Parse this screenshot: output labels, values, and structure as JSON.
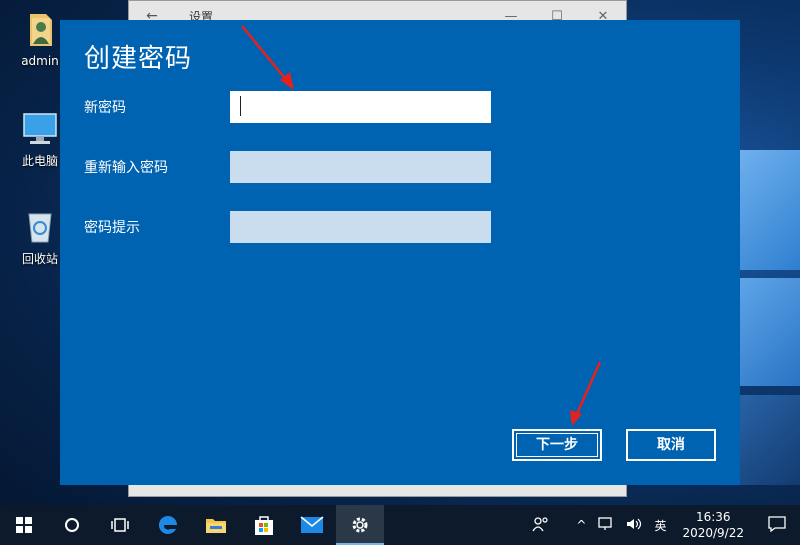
{
  "desktop": {
    "icons": [
      {
        "label": "admin"
      },
      {
        "label": "此电脑"
      },
      {
        "label": "回收站"
      }
    ]
  },
  "settings_window": {
    "title": "设置",
    "back_glyph": "←",
    "minimize_glyph": "—",
    "maximize_glyph": "☐",
    "close_glyph": "✕"
  },
  "dialog": {
    "title": "创建密码",
    "fields": [
      {
        "label": "新密码",
        "value": "",
        "state": "active"
      },
      {
        "label": "重新输入密码",
        "value": "",
        "state": "inactive"
      },
      {
        "label": "密码提示",
        "value": "",
        "state": "inactive"
      }
    ],
    "next_label": "下一步",
    "cancel_label": "取消"
  },
  "taskbar": {
    "items": [
      "start-icon",
      "search-icon",
      "task-view-icon",
      "edge-icon",
      "file-explorer-icon",
      "store-icon",
      "mail-icon",
      "settings-icon"
    ],
    "active_item": "settings-icon",
    "tray": {
      "people_icon": "people-icon",
      "chevron": "^",
      "network_icon": "network-icon",
      "volume_icon": "volume-icon",
      "ime": "英",
      "time": "16:36",
      "date": "2020/9/22",
      "notification_icon": "notification-icon"
    }
  },
  "colors": {
    "dialog_bg": "#0063b1",
    "active_input": "#ffffff",
    "inactive_input": "#c9ddee",
    "arrow": "#e8201c",
    "taskbar": "#0c1a2b"
  }
}
